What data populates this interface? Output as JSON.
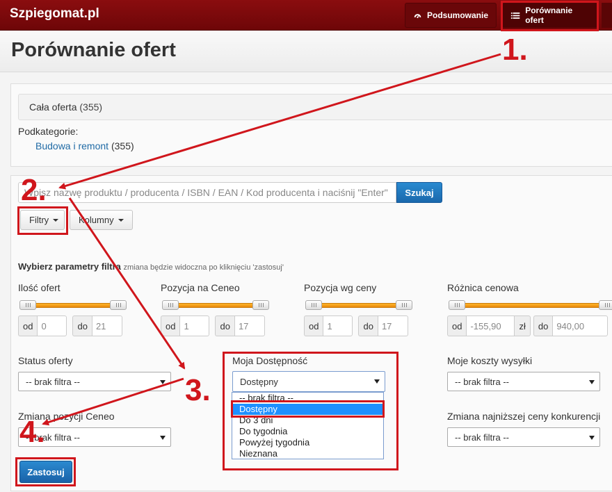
{
  "navbar": {
    "brand": "Szpiegomat.pl",
    "items": [
      {
        "label": "Podsumowanie",
        "icon": "dashboard-icon"
      },
      {
        "label": "Porównanie ofert",
        "icon": "list-icon"
      }
    ]
  },
  "page": {
    "title": "Porównanie ofert"
  },
  "offers": {
    "all_label": "Cała oferta",
    "all_count": "(355)",
    "subcategories_label": "Podkategorie:",
    "subcategory_link": "Budowa i remont",
    "subcategory_count": "(355)"
  },
  "search": {
    "placeholder": "Wpisz nazwę produktu / producenta / ISBN / EAN / Kod producenta i naciśnij \"Enter\"",
    "button": "Szukaj"
  },
  "toolbar": {
    "filters": "Filtry",
    "columns": "Kolumny"
  },
  "filters": {
    "heading": "Wybierz parametry filtra",
    "hint": "zmiana będzie widoczna po kliknięciu 'zastosuj'",
    "ranges": [
      {
        "label": "Ilość ofert",
        "from_label": "od",
        "from": "0",
        "to_label": "do",
        "to": "21",
        "fill_start": 0.0,
        "fill_end": 1.0
      },
      {
        "label": "Pozycja na Ceneo",
        "from_label": "od",
        "from": "1",
        "to_label": "do",
        "to": "17",
        "fill_start": 0.0,
        "fill_end": 1.0
      },
      {
        "label": "Pozycja wg ceny",
        "from_label": "od",
        "from": "1",
        "to_label": "do",
        "to": "17",
        "fill_start": 0.0,
        "fill_end": 1.0
      },
      {
        "label": "Różnica cenowa",
        "from_label": "od",
        "from": "-155,90",
        "unit": "zł",
        "to_label": "do",
        "to": "940,00",
        "fill_start": 0.0,
        "fill_end": 1.0
      }
    ],
    "status": {
      "label": "Status oferty",
      "value": "-- brak filtra --"
    },
    "availability": {
      "label": "Moja Dostępność",
      "value": "Dostępny",
      "options": [
        "-- brak filtra --",
        "Dostępny",
        "Do 3 dni",
        "Do tygodnia",
        "Powyżej tygodnia",
        "Nieznana"
      ],
      "highlighted": "Dostępny"
    },
    "shipping": {
      "label": "Moje koszty wysyłki",
      "value": "-- brak filtra --"
    },
    "position_change": {
      "label": "Zmiana pozycji Ceneo",
      "value": "-- brak filtra --"
    },
    "lowest_price_change": {
      "label": "Zmiana najniższej ceny konkurencji",
      "value": "-- brak filtra --"
    },
    "apply": "Zastosuj"
  },
  "annotations": {
    "steps": [
      "1.",
      "2.",
      "3.",
      "4."
    ],
    "color": "#d0161c"
  }
}
